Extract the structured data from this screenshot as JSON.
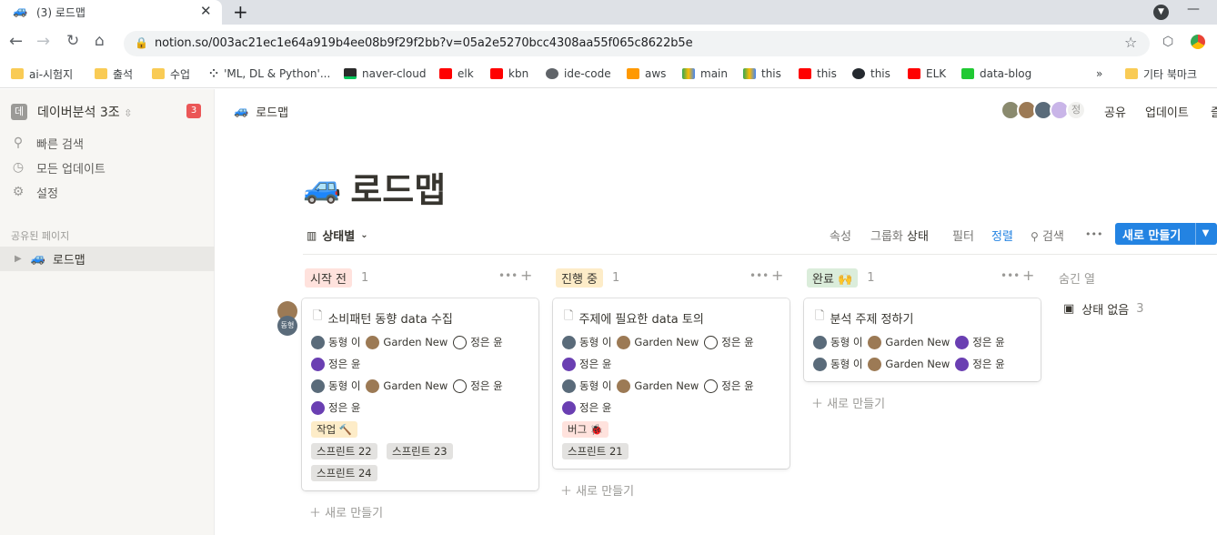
{
  "browser": {
    "tab_title": "(3) 로드맵",
    "url": "notion.so/003ac21ec1e64a919b4ee08b9f29f2bb?v=05a2e5270bcc4308aa55f065c8622b5e",
    "bookmarks": [
      "ai-시험지",
      "출석",
      "수업",
      "'ML, DL & Python'...",
      "naver-cloud",
      "elk",
      "kbn",
      "ide-code",
      "aws",
      "main",
      "this",
      "this",
      "this",
      "ELK",
      "data-blog"
    ],
    "overflow": "»",
    "other_bookmarks": "기타 북마크"
  },
  "sidebar": {
    "workspace_badge": "데",
    "workspace_name": "데이버분석 3조",
    "workspace_sort": "⌃",
    "notification_count": "3",
    "items": [
      {
        "icon": "search-icon",
        "label": "빠른 검색"
      },
      {
        "icon": "clock-icon",
        "label": "모든 업데이트"
      },
      {
        "icon": "gear-icon",
        "label": "설정"
      }
    ],
    "shared_header": "공유된 페이지",
    "shared_page": "로드맵"
  },
  "topbar": {
    "breadcrumb": "로드맵",
    "avatar_last": "정",
    "share": "공유",
    "updates": "업데이트",
    "more": "즐"
  },
  "page": {
    "title": "로드맵",
    "view_name": "상태별",
    "toolbar": {
      "properties": "속성",
      "group_prefix": "그룹화",
      "group_value": "상태",
      "filter": "필터",
      "sort": "정렬",
      "search": "검색",
      "more": "•••",
      "new": "새로 만들기"
    }
  },
  "board": {
    "new_item": "새로 만들기",
    "hidden_columns": "숨긴 열",
    "no_status": "상태 없음",
    "no_status_count": "3",
    "columns": [
      {
        "label": "시작 전",
        "count": "1",
        "color": "#ffe2dd"
      },
      {
        "label": "진행 중",
        "count": "1",
        "color": "#fdecc8"
      },
      {
        "label": "완료 🙌",
        "count": "1",
        "color": "#dbeddb"
      }
    ],
    "cards": [
      {
        "title": "소비패턴 동향 data 수집",
        "people": [
          "동형 이",
          "Garden New",
          "정은 윤",
          "정은 윤",
          "동형 이",
          "Garden New",
          "정은 윤",
          "정은 윤"
        ],
        "tags": [
          "작업 🔨"
        ],
        "sprints": [
          "스프린트 22",
          "스프린트 23",
          "스프린트 24"
        ]
      },
      {
        "title": "주제에 필요한 data 토의",
        "people": [
          "동형 이",
          "Garden New",
          "정은 윤",
          "정은 윤",
          "동형 이",
          "Garden New",
          "정은 윤",
          "정은 윤"
        ],
        "tags": [
          "버그 🐞"
        ],
        "sprints": [
          "스프린트 21"
        ]
      },
      {
        "title": "분석 주제 정하기",
        "people": [
          "동형 이",
          "Garden New",
          "정은 윤",
          "동형 이",
          "Garden New",
          "정은 윤"
        ]
      }
    ],
    "side_avatar": "동형"
  },
  "colors": {
    "accent": "#2383e2",
    "sprint_tag": "#e3e2e0",
    "task_tag": "#fdecc8",
    "bug_tag": "#ffe2dd"
  }
}
